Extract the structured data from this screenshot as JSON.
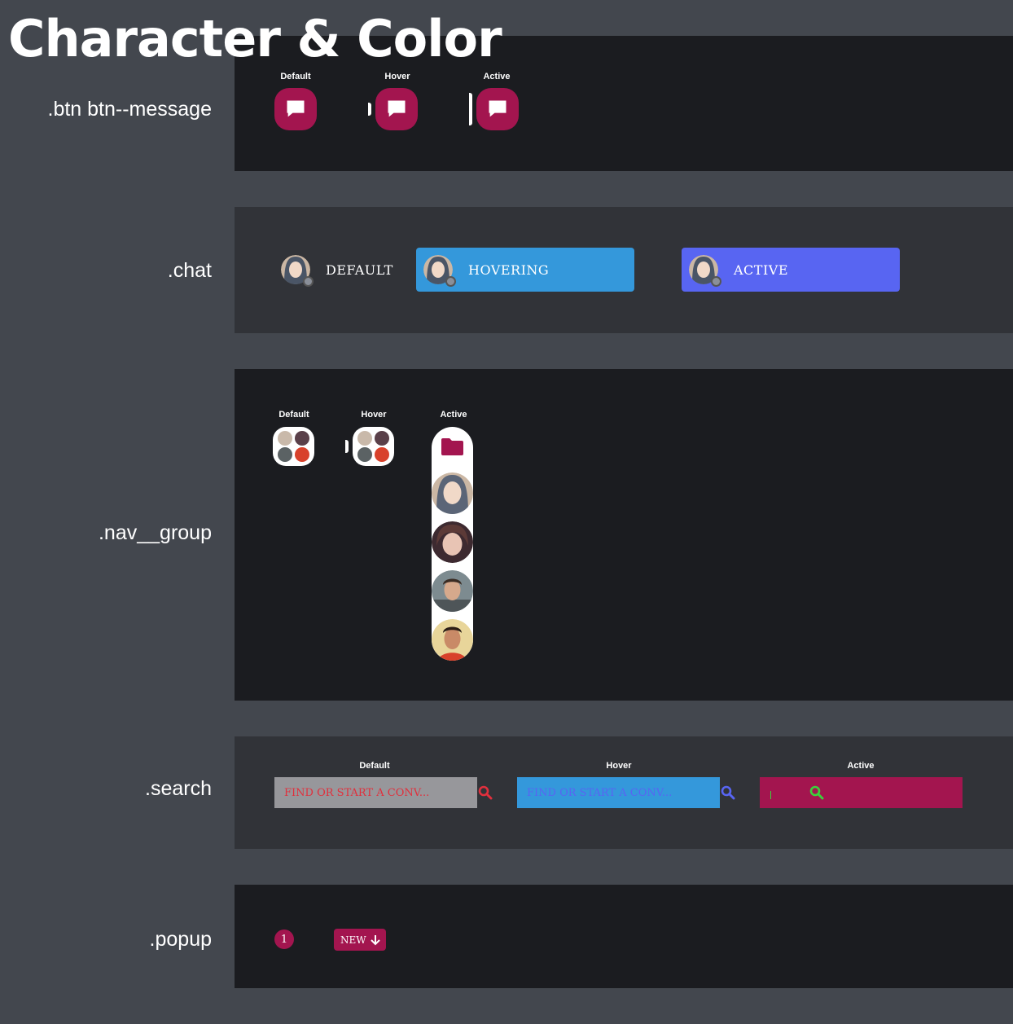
{
  "title": "Character & Color",
  "colors": {
    "page_bg": "#43474e",
    "panel_dark": "#1b1c20",
    "panel_mid": "#313338",
    "accent": "#a3154f",
    "hover_blue": "#3498db",
    "active_purple": "#5865f2"
  },
  "sections": {
    "message": {
      "label": ".btn btn--message",
      "states": [
        "Default",
        "Hover",
        "Active"
      ],
      "icon": "chat-bubble-icon"
    },
    "chat": {
      "label": ".chat",
      "items": [
        {
          "text": "Default"
        },
        {
          "text": "Hovering"
        },
        {
          "text": "Active"
        }
      ]
    },
    "nav_group": {
      "label": ".nav__group",
      "states": [
        "Default",
        "Hover",
        "Active"
      ],
      "folder_icon": "folder-icon"
    },
    "search": {
      "label": ".search",
      "states": [
        "Default",
        "Hover",
        "Active"
      ],
      "placeholder": "Find or start a conv...",
      "icon": "search-icon"
    },
    "popup": {
      "label": ".popup",
      "badge_count": "1",
      "new_label": "New",
      "arrow_icon": "arrow-down-icon"
    }
  }
}
